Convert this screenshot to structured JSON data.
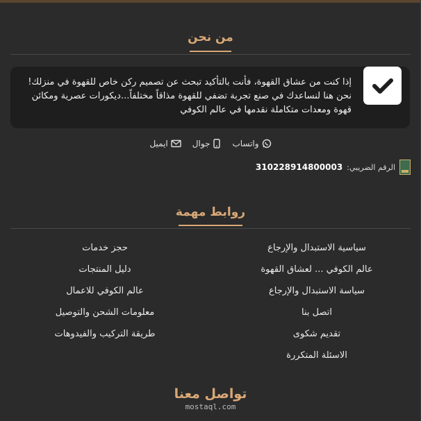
{
  "about": {
    "title": "من نحن",
    "text": "إذا كنت من عشاق القهوة، فأنت بالتأكيد تبحث عن تصميم ركن خاص للقهوة في منزلك! نحن هنا لنساعدك في صنع تجربة تضفي للقهوة مذاقاً مختلفاً...ديكورات عصرية ومكائن قهوة ومعدات متكاملة نقدمها في عالم الكوفي",
    "icon": "check-icon"
  },
  "contact": {
    "whatsapp": "واتساب",
    "mobile": "جوال",
    "email": "ايميل"
  },
  "tax": {
    "label": "الرقم الضريبي:",
    "number": "310228914800003"
  },
  "links": {
    "title": "روابط مهمة",
    "right_column": [
      "سياسية الاستبدال والإرجاع",
      "عالم الكوفي ... لعشاق القهوة",
      "سياسة الاستبدال والإرجاع",
      "اتصل بنا",
      "تقديم شكوى",
      "الاسئلة المتكررة"
    ],
    "left_column": [
      "حجز خدمات",
      "دليل المنتجات",
      "عالم الكوفي للاعمال",
      "معلومات الشحن والتوصيل",
      "طريقة التركيب والفيدوهات"
    ]
  },
  "footer": {
    "logo_text": "تواصل معنا",
    "watermark": "mostaql.com"
  },
  "colors": {
    "background": "#2b2b2b",
    "card": "#1e1e1e",
    "accent": "#d9a877"
  }
}
